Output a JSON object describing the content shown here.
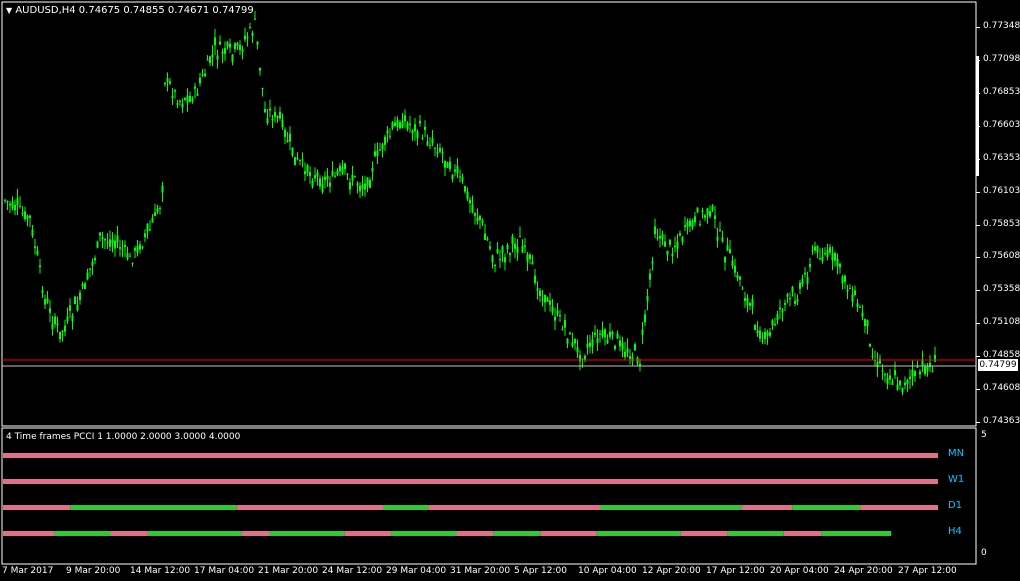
{
  "main_chart": {
    "symbol_line": "AUDUSD,H4  0.74675 0.74855 0.74671 0.74799",
    "price_labels": [
      "0.77348",
      "0.77098",
      "0.76853",
      "0.76603",
      "0.76353",
      "0.76103",
      "0.75853",
      "0.75608",
      "0.75358",
      "0.75108",
      "0.74858",
      "0.74608",
      "0.74363"
    ],
    "current_price": "0.74799",
    "colors": {
      "candle": "#00ff00",
      "background": "#000000",
      "grid": "#ffffff",
      "red_line": "#ff0000",
      "ask_line": "#c0c0c0"
    }
  },
  "indicator": {
    "title": "4 Time frames PCCI 1 1.0000 2.0000 3.0000 4.0000",
    "scale_top": "5",
    "scale_bottom": "0",
    "rows": [
      {
        "label": "MN",
        "segments": [
          {
            "color": "pink",
            "length": 1.0
          }
        ]
      },
      {
        "label": "W1",
        "segments": [
          {
            "color": "pink",
            "length": 1.0
          }
        ]
      },
      {
        "label": "D1",
        "segments": [
          {
            "color": "pink",
            "length": 0.072
          },
          {
            "color": "green",
            "length": 0.178
          },
          {
            "color": "pink",
            "length": 0.157
          },
          {
            "color": "green",
            "length": 0.048
          },
          {
            "color": "pink",
            "length": 0.184
          },
          {
            "color": "green",
            "length": 0.151
          },
          {
            "color": "pink",
            "length": 0.054
          },
          {
            "color": "green",
            "length": 0.073
          },
          {
            "color": "pink",
            "length": 0.083
          }
        ]
      },
      {
        "label": "H4",
        "segments": [
          {
            "color": "pink",
            "length": 0.055
          },
          {
            "color": "green",
            "length": 0.06
          },
          {
            "color": "pink",
            "length": 0.04
          },
          {
            "color": "green",
            "length": 0.1
          },
          {
            "color": "pink",
            "length": 0.03
          },
          {
            "color": "green",
            "length": 0.08
          },
          {
            "color": "pink",
            "length": 0.05
          },
          {
            "color": "green",
            "length": 0.07
          },
          {
            "color": "pink",
            "length": 0.04
          },
          {
            "color": "green",
            "length": 0.05
          },
          {
            "color": "pink",
            "length": 0.06
          },
          {
            "color": "green",
            "length": 0.09
          },
          {
            "color": "pink",
            "length": 0.05
          },
          {
            "color": "green",
            "length": 0.06
          },
          {
            "color": "pink",
            "length": 0.04
          },
          {
            "color": "green",
            "length": 0.075
          }
        ]
      }
    ],
    "colors": {
      "pink": "#e0708a",
      "green": "#32c832"
    }
  },
  "time_axis": [
    "7 Mar 2017",
    "9 Mar 20:00",
    "14 Mar 12:00",
    "17 Mar 04:00",
    "21 Mar 20:00",
    "24 Mar 12:00",
    "29 Mar 04:00",
    "31 Mar 20:00",
    "5 Apr 12:00",
    "10 Apr 04:00",
    "12 Apr 20:00",
    "17 Apr 12:00",
    "20 Apr 04:00",
    "24 Apr 20:00",
    "27 Apr 12:00"
  ]
}
